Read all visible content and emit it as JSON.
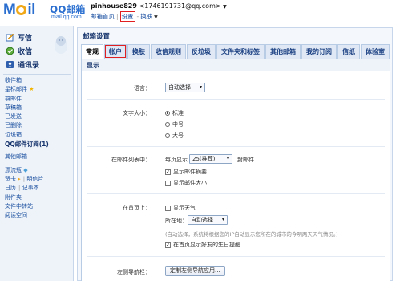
{
  "logo": {
    "mail": "Mail",
    "cn": "QQ邮箱",
    "domain": "mail.qq.com"
  },
  "user": {
    "name": "pinhouse829",
    "email": "<1746191731@qq.com>"
  },
  "top_links": {
    "home": "邮箱首页",
    "settings": "设置",
    "skin": "换肤"
  },
  "sidebar": {
    "commands": [
      {
        "label": "写信",
        "icon": "compose-icon"
      },
      {
        "label": "收信",
        "icon": "inbox-icon"
      },
      {
        "label": "通讯录",
        "icon": "contacts-icon"
      }
    ],
    "folders": [
      {
        "label": "收件箱"
      },
      {
        "label": "星标邮件"
      },
      {
        "label": "群邮件"
      },
      {
        "label": "草稿箱"
      },
      {
        "label": "已发送"
      },
      {
        "label": "已删除"
      },
      {
        "label": "垃圾箱"
      },
      {
        "label": "QQ邮件订阅(1)"
      }
    ],
    "other_mail": "其他邮箱",
    "apps": [
      {
        "a": "漂流瓶",
        "b": ""
      },
      {
        "a": "贺卡",
        "b": "明信片"
      },
      {
        "a": "日历",
        "b": "记事本"
      },
      {
        "a": "附件夹",
        "b": ""
      },
      {
        "a": "文件中转站",
        "b": ""
      },
      {
        "a": "阅读空间",
        "b": ""
      }
    ]
  },
  "main": {
    "title": "邮箱设置",
    "tabs": [
      "常规",
      "帐户",
      "换肤",
      "收信规则",
      "反垃圾",
      "文件夹和标签",
      "其他邮箱",
      "我的订阅",
      "信纸",
      "体验室"
    ],
    "active_tab": "常规",
    "section": "显示",
    "language": {
      "label": "语言：",
      "value": "自动选择"
    },
    "font_size": {
      "label": "文字大小：",
      "options": [
        "标准",
        "中号",
        "大号"
      ],
      "selected": "标准"
    },
    "list": {
      "label": "在邮件列表中：",
      "per_page_prefix": "每页显示",
      "per_page_value": "25(推荐)",
      "per_page_suffix": "封邮件",
      "show_summary": "显示邮件摘要",
      "show_size": "显示邮件大小"
    },
    "home": {
      "label": "在首页上：",
      "show_weather": "显示天气",
      "location_label": "所在地：",
      "location_value": "自动选择",
      "weather_note": "(自动选择，系统将根据您的IP自动显示您所在的城市的今明两天天气情况。)",
      "show_birthdays": "在首页显示好友的生日提醒"
    },
    "left_nav": {
      "label": "左侧导航栏：",
      "button": "定制左侧导航应用..."
    }
  }
}
